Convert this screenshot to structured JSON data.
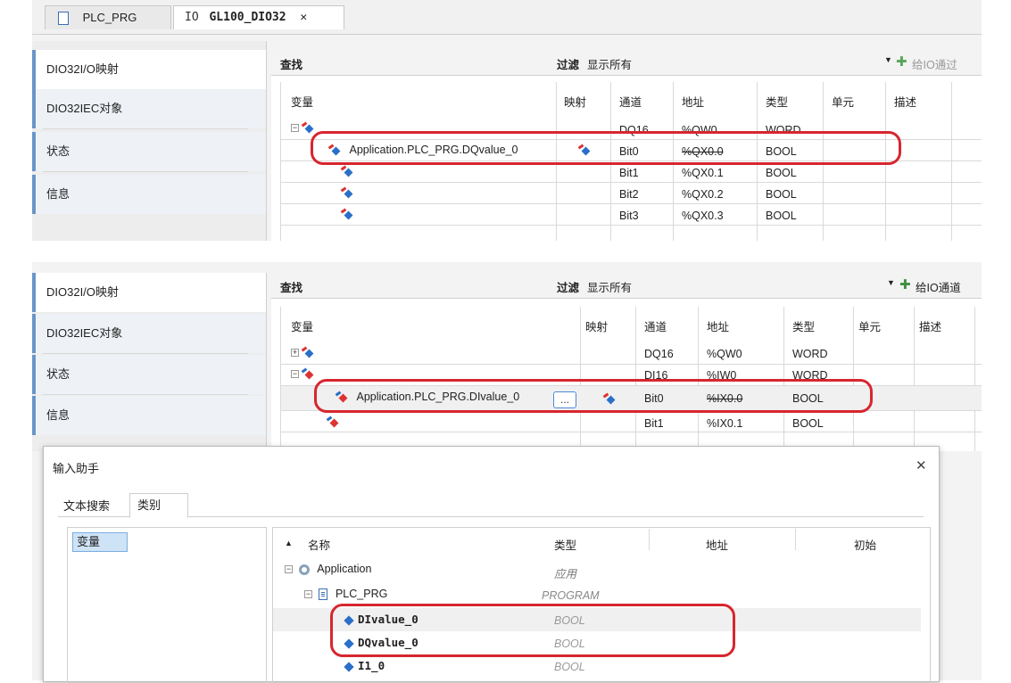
{
  "tabs": [
    {
      "icon": "document-icon",
      "label": "PLC_PRG"
    },
    {
      "prefix": "IO",
      "label": "GL100_DIO32",
      "close": "✕"
    }
  ],
  "sidebar": {
    "items": [
      "DIO32I/O映射",
      "DIO32IEC对象",
      "状态",
      "信息"
    ]
  },
  "toolbar": {
    "find": "查找",
    "filter_label": "过滤",
    "filter_value": "显示所有",
    "add_channel": "给IO通道",
    "add_channel_top": "给IO通过"
  },
  "columns": [
    "变量",
    "映射",
    "通道",
    "地址",
    "类型",
    "单元",
    "描述"
  ],
  "top_rows": [
    {
      "variable": "",
      "mapping": "",
      "channel": "DQ16",
      "address": "%QW0",
      "type": "WORD",
      "strike": false
    },
    {
      "variable": "Application.PLC_PRG.DQvalue_0",
      "mapping": "mapped",
      "channel": "Bit0",
      "address": "%QX0.0",
      "type": "BOOL",
      "strike": true
    },
    {
      "variable": "",
      "mapping": "",
      "channel": "Bit1",
      "address": "%QX0.1",
      "type": "BOOL",
      "strike": false
    },
    {
      "variable": "",
      "mapping": "",
      "channel": "Bit2",
      "address": "%QX0.2",
      "type": "BOOL",
      "strike": false
    },
    {
      "variable": "",
      "mapping": "",
      "channel": "Bit3",
      "address": "%QX0.3",
      "type": "BOOL",
      "strike": false
    }
  ],
  "bottom_rows": [
    {
      "variable": "",
      "channel": "DQ16",
      "address": "%QW0",
      "type": "WORD",
      "strike": false
    },
    {
      "variable": "",
      "channel": "DI16",
      "address": "%IW0",
      "type": "WORD",
      "strike": false
    },
    {
      "variable": "Application.PLC_PRG.DIvalue_0",
      "channel": "Bit0",
      "address": "%IX0.0",
      "type": "BOOL",
      "strike": true,
      "button": "..."
    },
    {
      "variable": "",
      "channel": "Bit1",
      "address": "%IX0.1",
      "type": "BOOL",
      "strike": false
    }
  ],
  "dialog": {
    "title": "输入助手",
    "close": "✕",
    "tabs": [
      "文本搜索",
      "类别"
    ],
    "category": "变量",
    "columns": [
      "名称",
      "类型",
      "地址",
      "初始"
    ],
    "sort_indicator": "▲",
    "tree": [
      {
        "name": "Application",
        "type": "应用",
        "bold": false
      },
      {
        "name": "PLC_PRG",
        "type": "PROGRAM",
        "bold": false
      },
      {
        "name": "DIvalue_0",
        "type": "BOOL",
        "bold": true
      },
      {
        "name": "DQvalue_0",
        "type": "BOOL",
        "bold": true
      },
      {
        "name": "I1_0",
        "type": "BOOL",
        "bold": true
      }
    ]
  },
  "colors": {
    "highlight": "#d7262e",
    "accent": "#6a95c8"
  }
}
